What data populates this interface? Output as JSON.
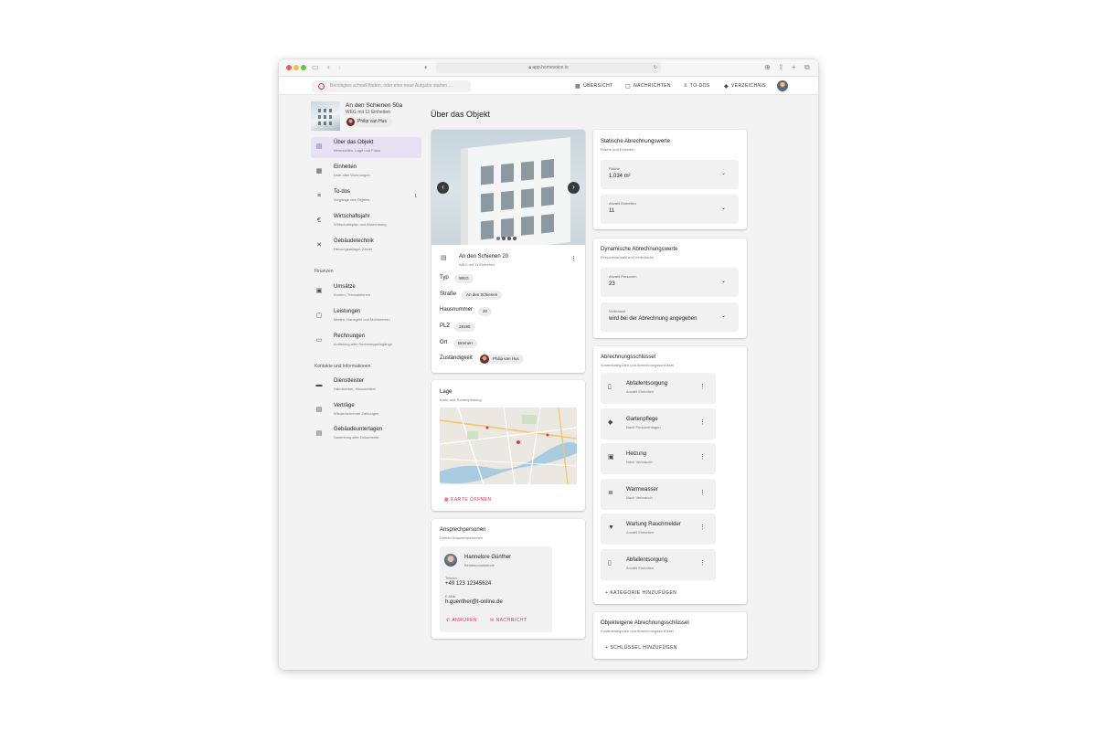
{
  "browser": {
    "url": "app.homevoice.io"
  },
  "search": {
    "placeholder": "Benötigtes schnell finden, oder eine neue Aufgabe starten ..."
  },
  "nav": [
    {
      "label": "ÜBERSICHT",
      "icon": "grid-icon"
    },
    {
      "label": "NACHRICHTEN",
      "icon": "chat-icon"
    },
    {
      "label": "TO-DOS",
      "icon": "list-icon"
    },
    {
      "label": "VERZEICHNIS",
      "icon": "book-icon"
    }
  ],
  "object": {
    "title": "An den Schienen 50a",
    "subtitle": "WEG mit 11 Einheiten",
    "owner": "Philip van Hus"
  },
  "sidebar": {
    "items": [
      {
        "label": "Über das Objekt",
        "sub": "Kennzahlen, Lage und Fotos",
        "icon": "building-icon",
        "active": true
      },
      {
        "label": "Einheiten",
        "sub": "Liste aller Wohnungen",
        "icon": "apps-icon"
      },
      {
        "label": "To-dos",
        "sub": "Vorgänge des Objekts",
        "icon": "list-icon",
        "count": "1"
      },
      {
        "label": "Wirtschaftsjahr",
        "sub": "Wirtschaftsplan und Abrechnung",
        "icon": "euro-icon"
      },
      {
        "label": "Gebäudetechnik",
        "sub": "Heizungsanlage, Zähler",
        "icon": "tools-icon"
      }
    ],
    "section_finance": "Finanzen",
    "finance": [
      {
        "label": "Umsätze",
        "sub": "Konten, Transaktionen",
        "icon": "wallet-icon"
      },
      {
        "label": "Leistungen",
        "sub": "Mieten, Hausgeld und Mahnwesen",
        "icon": "inbox-icon"
      },
      {
        "label": "Rechnungen",
        "sub": "Auflistung aller Rechnungseingänge",
        "icon": "card-icon"
      }
    ],
    "section_contacts": "Kontakte und Informationen",
    "contacts": [
      {
        "label": "Dienstleister",
        "sub": "Handwerker, Hausmeister",
        "icon": "briefcase-icon"
      },
      {
        "label": "Verträge",
        "sub": "Wiederkehrende Zahlungen",
        "icon": "document-icon"
      },
      {
        "label": "Gebäudeunterlagen",
        "sub": "Sammlung aller Dokumente",
        "icon": "file-icon"
      }
    ]
  },
  "page_title": "Über das Objekt",
  "info_card": {
    "name": "An den Schienen 20",
    "sub": "WEG mit 11 Einheiten",
    "rows": [
      {
        "label": "Typ",
        "value": "WEG"
      },
      {
        "label": "Straße",
        "value": "An den Schienen"
      },
      {
        "label": "Hausnummer",
        "value": "20"
      },
      {
        "label": "PLZ",
        "value": "28195"
      },
      {
        "label": "Ort",
        "value": "Bremen"
      },
      {
        "label": "Zuständigkeit",
        "value": "Philip van Hus"
      }
    ]
  },
  "location": {
    "title": "Lage",
    "subtitle": "Karte und Routenplanung",
    "button": "KARTE ÖFFNEN"
  },
  "contacts_card": {
    "title": "Ansprechpersonen",
    "subtitle": "Direkte Ansprechpersonen",
    "name": "Hannelore Günther",
    "role": "Beiratsvorsitzende",
    "phone_label": "Telefon",
    "phone": "+49 123 12345624",
    "email_label": "E-Mail",
    "email": "h.guenther@t-online.de",
    "call": "ANRUFEN",
    "message": "NACHRICHT"
  },
  "static_values": {
    "title": "Statische Abrechnungswerte",
    "subtitle": "Fläche und Einheiten",
    "fields": [
      {
        "label": "Fläche",
        "value": "1.034 m²"
      },
      {
        "label": "Anzahl Einheiten",
        "value": "11"
      }
    ]
  },
  "dynamic_values": {
    "title": "Dynamische Abrechnungswerte",
    "subtitle": "Personenanzahl und Verbräuche",
    "fields": [
      {
        "label": "Anzahl Personen",
        "value": "23"
      },
      {
        "label": "Verbrauch",
        "value": "wird bei der Abrechnung angegeben"
      }
    ]
  },
  "keys": {
    "title": "Abrechnungsschlüssel",
    "subtitle": "Kostenkategorien und Abrechnungsschlüssel",
    "items": [
      {
        "label": "Abfallentsorgung",
        "sub": "Anzahl Einheiten",
        "icon": "trash-icon"
      },
      {
        "label": "Gartenpflege",
        "sub": "Nach Personentagen",
        "icon": "leaf-icon"
      },
      {
        "label": "Heizung",
        "sub": "Nach Verbrauch",
        "icon": "heating-icon"
      },
      {
        "label": "Warmwasser",
        "sub": "Nach Verbrauch",
        "icon": "water-icon"
      },
      {
        "label": "Wartung Rauchmelder",
        "sub": "Anzahl Einheiten",
        "icon": "smoke-detector-icon"
      },
      {
        "label": "Abfallentsorgung",
        "sub": "Anzahl Einheiten",
        "icon": "trash-icon"
      }
    ],
    "add": "KATEGORIE HINZUFÜGEN"
  },
  "own_keys": {
    "title": "Objekteigene Abrechnungsschlüssel",
    "subtitle": "Kostenkategorien und Abrechnungsschlüssel",
    "add": "SCHLÜSSEL HINZUFÜGEN"
  }
}
